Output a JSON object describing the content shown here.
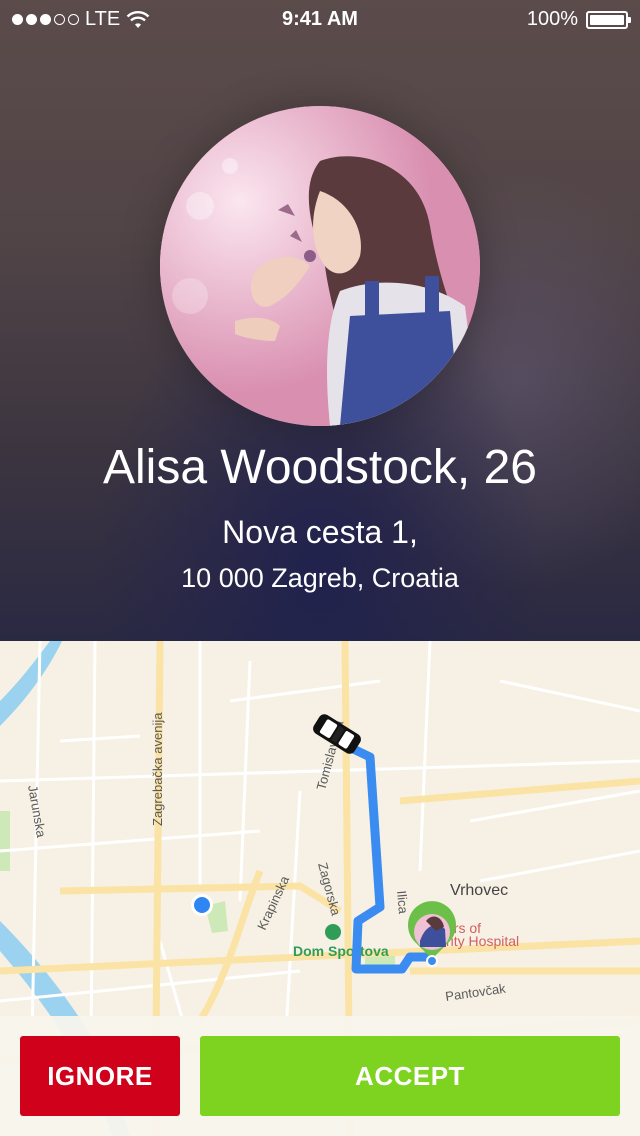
{
  "status_bar": {
    "carrier": "LTE",
    "time": "9:41 AM",
    "battery": "100%"
  },
  "profile": {
    "name_age": "Alisa Woodstock, 26",
    "address_line1": "Nova cesta 1,",
    "address_line2": "10 000 Zagreb, Croatia"
  },
  "map": {
    "streets": {
      "zagrebacka": "Zagrebačka avenija",
      "jarunska": "Jarunska",
      "tomislavova": "Tomislavova",
      "zagorska": "Zagorska",
      "krapinska": "Krapinska",
      "ilica": "Ilica",
      "vrhovec": "Vrhovec",
      "pantovcak": "Pantovčak"
    },
    "pois": {
      "dom_sportova": "Dom Sportova",
      "hospital_line1": "ers of",
      "hospital_line2": "rity Hospital"
    },
    "colors": {
      "route": "#3b8cf0",
      "pin": "#6cc04a"
    }
  },
  "actions": {
    "ignore_label": "IGNORE",
    "accept_label": "ACCEPT",
    "ignore_color": "#d0021b",
    "accept_color": "#7ed321"
  }
}
